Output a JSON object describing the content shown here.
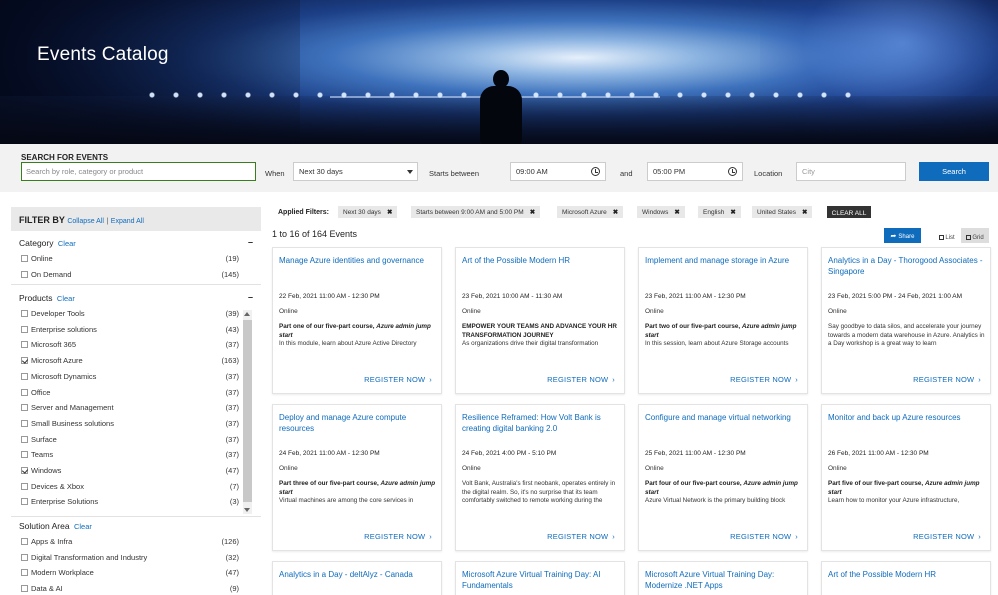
{
  "hero": {
    "title": "Events Catalog"
  },
  "search": {
    "label": "SEARCH FOR EVENTS",
    "placeholder": "Search by role, category or product",
    "when_label": "When",
    "when_value": "Next 30 days",
    "starts_between_label": "Starts between",
    "start_time": "09:00 AM",
    "and_label": "and",
    "end_time": "05:00 PM",
    "location_label": "Location",
    "location_placeholder": "City",
    "button": "Search"
  },
  "filter": {
    "title": "FILTER BY",
    "collapse_all": "Collapse All",
    "separator": "|",
    "expand_all": "Expand All",
    "clear": "Clear",
    "groups": [
      {
        "title": "Category",
        "items": [
          {
            "name": "Online",
            "count": "(19)",
            "checked": false
          },
          {
            "name": "On Demand",
            "count": "(145)",
            "checked": false
          }
        ]
      },
      {
        "title": "Products",
        "items": [
          {
            "name": "Developer Tools",
            "count": "(39)",
            "checked": false
          },
          {
            "name": "Enterprise solutions",
            "count": "(43)",
            "checked": false
          },
          {
            "name": "Microsoft 365",
            "count": "(37)",
            "checked": false
          },
          {
            "name": "Microsoft Azure",
            "count": "(163)",
            "checked": true
          },
          {
            "name": "Microsoft Dynamics",
            "count": "(37)",
            "checked": false
          },
          {
            "name": "Office",
            "count": "(37)",
            "checked": false
          },
          {
            "name": "Server and Management",
            "count": "(37)",
            "checked": false
          },
          {
            "name": "Small Business solutions",
            "count": "(37)",
            "checked": false
          },
          {
            "name": "Surface",
            "count": "(37)",
            "checked": false
          },
          {
            "name": "Teams",
            "count": "(37)",
            "checked": false
          },
          {
            "name": "Windows",
            "count": "(47)",
            "checked": true
          },
          {
            "name": "Devices & Xbox",
            "count": "(7)",
            "checked": false
          },
          {
            "name": "Enterprise Solutions",
            "count": "(3)",
            "checked": false
          }
        ]
      },
      {
        "title": "Solution Area",
        "items": [
          {
            "name": "Apps & Infra",
            "count": "(126)",
            "checked": false
          },
          {
            "name": "Digital Transformation and Industry",
            "count": "(32)",
            "checked": false
          },
          {
            "name": "Modern Workplace",
            "count": "(47)",
            "checked": false
          },
          {
            "name": "Data & AI",
            "count": "(9)",
            "checked": false
          }
        ]
      }
    ]
  },
  "applied": {
    "label": "Applied Filters:",
    "chips": [
      "Next 30 days",
      "Starts between 9:00 AM and 5:00 PM",
      "Microsoft Azure",
      "Windows",
      "English",
      "United States"
    ],
    "remove_glyph": "✖",
    "clear_all": "CLEAR ALL"
  },
  "results": {
    "summary": "1 to 16 of 164 Events",
    "share": "Share",
    "list": "List",
    "grid": "Grid"
  },
  "register_label": "REGISTER NOW",
  "events": [
    {
      "title": "Manage Azure identities and governance",
      "date": "22 Feb, 2021 11:00 AM - 12:30 PM",
      "mode": "Online",
      "bold": "Part one of our five-part course, ",
      "bold_italic": "Azure admin jump start",
      "desc": "In this module, learn about Azure Active Directory"
    },
    {
      "title": "Art of the Possible Modern HR",
      "date": "23 Feb, 2021 10:00 AM - 11:30 AM",
      "mode": "Online",
      "bold": "EMPOWER YOUR TEAMS AND ADVANCE YOUR HR TRANSFORMATION JOURNEY",
      "bold_italic": "",
      "desc": "As organizations drive their digital transformation"
    },
    {
      "title": "Implement and manage storage in Azure",
      "date": "23 Feb, 2021 11:00 AM - 12:30 PM",
      "mode": "Online",
      "bold": "Part two of our five-part course, ",
      "bold_italic": "Azure admin jump start",
      "desc": "In this session, learn about Azure Storage accounts"
    },
    {
      "title": "Analytics in a Day - Thorogood Associates - Singapore",
      "date": "23 Feb, 2021 5:00 PM - 24 Feb, 2021 1:00 AM",
      "mode": "Online",
      "bold": "",
      "bold_italic": "",
      "desc": "Say goodbye to data silos, and accelerate your journey towards a modern data warehouse in Azure. Analytics in a Day workshop is a great way to learn"
    },
    {
      "title": "Deploy and manage Azure compute resources",
      "date": "24 Feb, 2021 11:00 AM - 12:30 PM",
      "mode": "Online",
      "bold": "Part three of our five-part course, ",
      "bold_italic": "Azure admin jump start",
      "desc": "Virtual machines are among the core services in"
    },
    {
      "title": "Resilience Reframed: How Volt Bank is creating digital banking 2.0",
      "date": "24 Feb, 2021 4:00 PM - 5:10 PM",
      "mode": "Online",
      "bold": "",
      "bold_italic": "",
      "desc": "Volt Bank, Australia's first neobank, operates entirely in the digital realm. So, it's no surprise that its team comfortably switched to remote working during the"
    },
    {
      "title": "Configure and manage virtual networking",
      "date": "25 Feb, 2021 11:00 AM - 12:30 PM",
      "mode": "Online",
      "bold": "Part four of our five-part course, ",
      "bold_italic": "Azure admin jump start",
      "desc": "Azure Virtual Network is the primary building block"
    },
    {
      "title": "Monitor and back up Azure resources",
      "date": "26 Feb, 2021 11:00 AM - 12:30 PM",
      "mode": "Online",
      "bold": "Part five of our five-part course, ",
      "bold_italic": "Azure admin jump start",
      "desc": "Learn how to monitor your Azure infrastructure,"
    },
    {
      "title": "Analytics in a Day - deltAlyz - Canada",
      "date": "",
      "mode": "",
      "bold": "",
      "bold_italic": "",
      "desc": ""
    },
    {
      "title": "Microsoft Azure Virtual Training Day: AI Fundamentals",
      "date": "",
      "mode": "",
      "bold": "",
      "bold_italic": "",
      "desc": ""
    },
    {
      "title": "Microsoft Azure Virtual Training Day: Modernize .NET Apps",
      "date": "",
      "mode": "",
      "bold": "",
      "bold_italic": "",
      "desc": ""
    },
    {
      "title": "Art of the Possible Modern HR",
      "date": "",
      "mode": "",
      "bold": "",
      "bold_italic": "",
      "desc": ""
    }
  ]
}
